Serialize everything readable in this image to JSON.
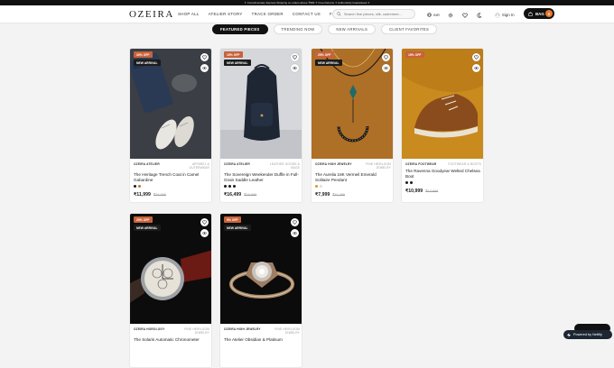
{
  "announcement": "✦ Complimentary Express Shipping on orders above ₹999 ✦ Free Returns ✦ Authenticity Guaranteed ✦",
  "header": {
    "logo": "OZEIRA",
    "nav": [
      "SHOP ALL",
      "ATELIER STORY",
      "TRACK ORDER",
      "CONTACT US",
      "FAQ"
    ],
    "search_placeholder": "Search fine pieces, silk, cashmere…",
    "currency": "INR",
    "signin": "Sign In",
    "bag_label": "BAG",
    "bag_count": "0"
  },
  "tabs": [
    {
      "label": "FEATURED PIECES",
      "active": true
    },
    {
      "label": "TRENDING NOW",
      "active": false
    },
    {
      "label": "NEW ARRIVALS",
      "active": false
    },
    {
      "label": "CLIENT FAVORITES",
      "active": false
    }
  ],
  "products": [
    {
      "off": "30% OFF",
      "new": "NEW ARRIVAL",
      "brand": "OZEIRA ATELIER",
      "category": "APPAREL & OUTERWEAR",
      "name": "The Heritage Trench Coat in Camel Gabardine",
      "price": "₹11,999",
      "mrp": "₹16,999",
      "colors": [
        "#1b1b1b",
        "#b07a3c"
      ]
    },
    {
      "off": "15% OFF",
      "new": "NEW ARRIVAL",
      "brand": "OZEIRA ATELIER",
      "category": "LEATHER GOODS & BAGS",
      "name": "The Sovereign Weekender Duffle in Full-Grain Saddle Leather",
      "price": "₹16,499",
      "mrp": "₹19,999",
      "colors": [
        "#1b1b1b",
        "#1b1b1b",
        "#1b1b1b"
      ]
    },
    {
      "off": "25% OFF",
      "new": "NEW ARRIVAL",
      "brand": "OZEIRA HIGH JEWELRY",
      "category": "FINE HEIRLOOM JEWELRY",
      "name": "The Aurelia 18K Vermeil Emerald Solitaire Pendant",
      "price": "₹7,999",
      "mrp": "₹11,499",
      "colors": [
        "#d99a2b",
        "#e0e0e0"
      ]
    },
    {
      "off": "15% OFF",
      "new": "",
      "brand": "OZEIRA FOOTWEAR",
      "category": "FOOTWEAR & BOOTS",
      "name": "The Ravenna Goodyear Welted Chelsea Boot",
      "price": "₹10,999",
      "mrp": "₹12,999",
      "colors": [
        "#1b1b1b",
        "#1b1b1b"
      ]
    },
    {
      "off": "20% OFF",
      "new": "NEW ARRIVAL",
      "brand": "OZEIRA HOROLOGY",
      "category": "FINE HEIRLOOM JEWELRY",
      "name": "The Solaris Automatic Chronometer",
      "price": "",
      "mrp": "",
      "colors": []
    },
    {
      "off": "5% OFF",
      "new": "NEW ARRIVAL",
      "brand": "OZEIRA HIGH JEWELRY",
      "category": "FINE HEIRLOOM JEWELRY",
      "name": "The Atelier Obsidian & Platinum",
      "price": "",
      "mrp": "",
      "colors": []
    }
  ],
  "widget": {
    "powered_by": "Powered by Nettify"
  },
  "colors": {
    "accent": "#c8623a",
    "dark": "#111111",
    "badge_count": "#e87a2c"
  }
}
